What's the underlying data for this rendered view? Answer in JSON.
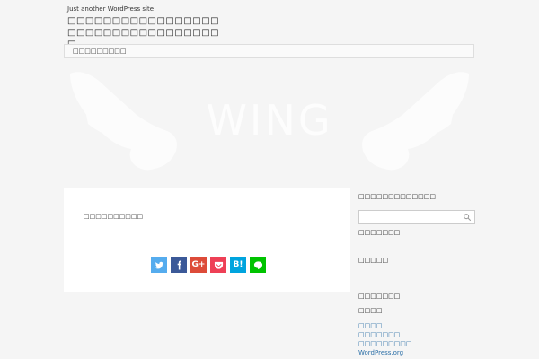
{
  "header": {
    "tagline": "Just another WordPress site",
    "site_title": "□□□□□□□□□□□□□□□□□□□□□□□□□□□□□□□□□□□"
  },
  "nav": {
    "items": [
      {
        "label": "□□□□□□□□□"
      }
    ]
  },
  "hero": {
    "brand_text": "WING"
  },
  "main": {
    "post_text": "□□□□□□□□□□",
    "share_buttons": [
      {
        "service": "twitter",
        "icon": "twitter-icon",
        "color": "#55acee"
      },
      {
        "service": "facebook",
        "icon": "facebook-icon",
        "color": "#3b5998"
      },
      {
        "service": "google-plus",
        "label": "G+",
        "icon": "google-plus-icon",
        "color": "#dd4b39"
      },
      {
        "service": "pocket",
        "icon": "pocket-icon",
        "color": "#ee4056"
      },
      {
        "service": "hatena",
        "label": "B!",
        "icon": "hatena-bookmark-icon",
        "color": "#00a4de"
      },
      {
        "service": "line",
        "icon": "line-icon",
        "color": "#00c300"
      }
    ]
  },
  "sidebar": {
    "title": "□□□□□□□□□□□□□",
    "search_placeholder": "",
    "recent_heading": "□□□□□□□",
    "archives_heading": "□□□□□",
    "categories_heading": "□□□□□□□",
    "meta_heading": "□□□□",
    "meta_links": [
      "□□□□",
      "□□□□□□□",
      "□□□□□□□□□",
      "WordPress.org"
    ]
  }
}
